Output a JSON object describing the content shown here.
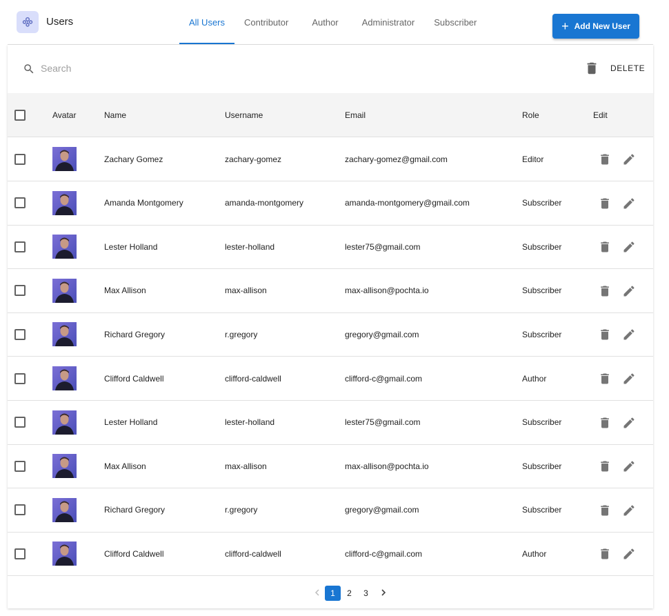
{
  "header": {
    "title": "Users",
    "tabs": [
      "All Users",
      "Contributor",
      "Author",
      "Administrator",
      "Subscriber"
    ],
    "active_tab": "All Users",
    "add_button_label": "Add New User"
  },
  "toolbar": {
    "search_placeholder": "Search",
    "delete_label": "DELETE"
  },
  "table": {
    "columns": [
      "Avatar",
      "Name",
      "Username",
      "Email",
      "Role",
      "Edit"
    ],
    "rows": [
      {
        "name": "Zachary Gomez",
        "username": "zachary-gomez",
        "email": "zachary-gomez@gmail.com",
        "role": "Editor"
      },
      {
        "name": "Amanda Montgomery",
        "username": "amanda-montgomery",
        "email": "amanda-montgomery@gmail.com",
        "role": "Subscriber"
      },
      {
        "name": "Lester Holland",
        "username": "lester-holland",
        "email": "lester75@gmail.com",
        "role": "Subscriber"
      },
      {
        "name": "Max Allison",
        "username": "max-allison",
        "email": "max-allison@pochta.io",
        "role": "Subscriber"
      },
      {
        "name": "Richard Gregory",
        "username": "r.gregory",
        "email": "gregory@gmail.com",
        "role": "Subscriber"
      },
      {
        "name": "Clifford Caldwell",
        "username": "clifford-caldwell",
        "email": "clifford-c@gmail.com",
        "role": "Author"
      },
      {
        "name": "Lester Holland",
        "username": "lester-holland",
        "email": "lester75@gmail.com",
        "role": "Subscriber"
      },
      {
        "name": "Max Allison",
        "username": "max-allison",
        "email": "max-allison@pochta.io",
        "role": "Subscriber"
      },
      {
        "name": "Richard Gregory",
        "username": "r.gregory",
        "email": "gregory@gmail.com",
        "role": "Subscriber"
      },
      {
        "name": "Clifford Caldwell",
        "username": "clifford-caldwell",
        "email": "clifford-c@gmail.com",
        "role": "Author"
      }
    ]
  },
  "pagination": {
    "pages": [
      "1",
      "2",
      "3"
    ],
    "current": "1"
  },
  "colors": {
    "accent": "#1976d2",
    "app_icon_bg": "#d9defb",
    "icon_gray": "#757575",
    "header_row_bg": "#f4f4f4"
  }
}
